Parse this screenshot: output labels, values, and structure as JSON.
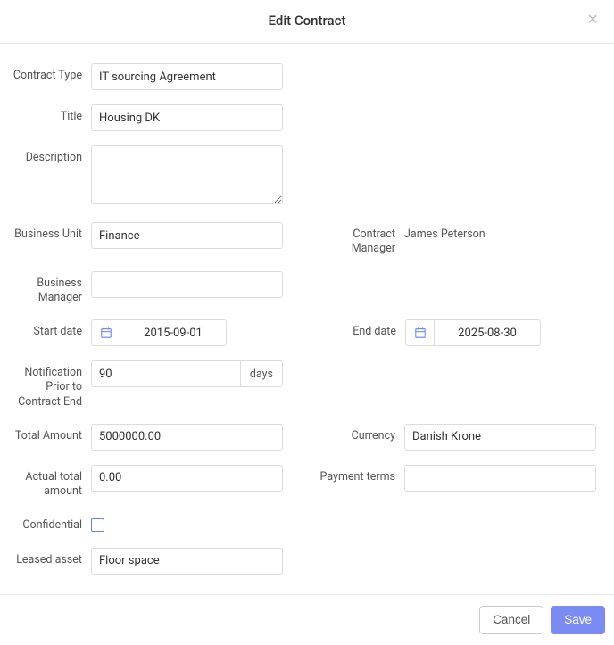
{
  "header": {
    "title": "Edit Contract",
    "close": "×"
  },
  "labels": {
    "contractType": "Contract Type",
    "title": "Title",
    "description": "Description",
    "businessUnit": "Business Unit",
    "contractManager": "Contract Manager",
    "businessManager": "Business Manager",
    "startDate": "Start date",
    "endDate": "End date",
    "notificationPrior": "Notification Prior to Contract End",
    "totalAmount": "Total Amount",
    "currency": "Currency",
    "actualTotalAmount": "Actual total amount",
    "paymentTerms": "Payment terms",
    "confidential": "Confidential",
    "leasedAsset": "Leased asset",
    "daysSuffix": "days"
  },
  "values": {
    "contractType": "IT sourcing Agreement",
    "title": "Housing DK",
    "description": "",
    "businessUnit": "Finance",
    "contractManager": "James Peterson",
    "businessManager": "",
    "startDate": "2015-09-01",
    "endDate": "2025-08-30",
    "notificationDays": "90",
    "totalAmount": "5000000.00",
    "currency": "Danish Krone",
    "actualTotalAmount": "0.00",
    "paymentTerms": "",
    "leasedAsset": "Floor space"
  },
  "footer": {
    "cancel": "Cancel",
    "save": "Save"
  }
}
